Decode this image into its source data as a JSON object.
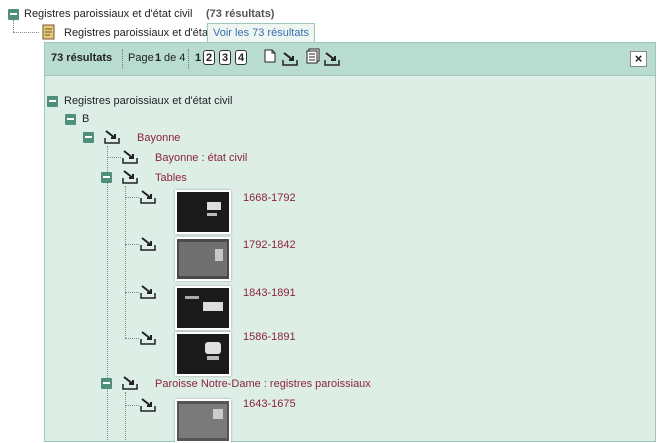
{
  "top": {
    "root_label": "Registres paroissiaux et d'état civil",
    "root_count": "(73 résultats)",
    "sub_label": "Registres paroissiaux et d'état civil",
    "voir_tab": "Voir les 73 résultats"
  },
  "toolbar": {
    "results": "73 résultats",
    "page_word": "Page",
    "page_current": "1",
    "page_of": "de 4",
    "pages": [
      "1",
      "2",
      "3",
      "4"
    ],
    "close": "×"
  },
  "tree": {
    "root": "Registres paroissiaux et d'état civil",
    "letter": "B",
    "bayonne": "Bayonne",
    "etat_civil": "Bayonne : état civil",
    "tables": "Tables",
    "table_items": [
      "1668-1792",
      "1792-1842",
      "1843-1891",
      "1586-1891"
    ],
    "paroisse": "Paroisse Notre-Dame : registres paroissiaux",
    "paroisse_items": [
      "1643-1675"
    ]
  }
}
